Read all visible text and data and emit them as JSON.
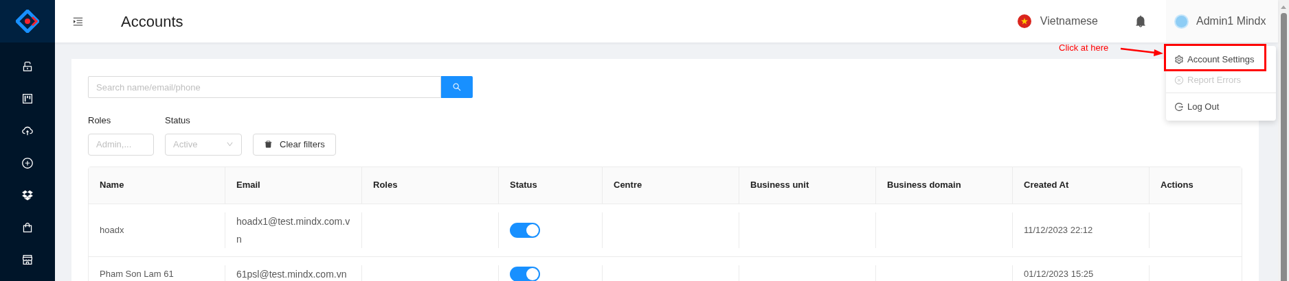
{
  "header": {
    "title": "Accounts",
    "language": "Vietnamese",
    "user": "Admin1 Mindx"
  },
  "user_menu": {
    "items": [
      {
        "kind": "settings",
        "label": "Account Settings",
        "disabled": false
      },
      {
        "kind": "report",
        "label": "Report Errors",
        "disabled": true
      },
      {
        "kind": "logout",
        "label": "Log Out",
        "disabled": false
      }
    ]
  },
  "annotation": {
    "text": "Click at here"
  },
  "search": {
    "placeholder": "Search name/email/phone"
  },
  "filters": {
    "roles": {
      "label": "Roles",
      "placeholder": "Admin,..."
    },
    "status": {
      "label": "Status",
      "placeholder": "Active"
    },
    "clear_button": "Clear filters"
  },
  "table": {
    "columns": [
      "Name",
      "Email",
      "Roles",
      "Status",
      "Centre",
      "Business unit",
      "Business domain",
      "Created At",
      "Actions"
    ],
    "rows": [
      {
        "name": "hoadx",
        "email": "hoadx1@test.mindx.com.vn",
        "status_on": true,
        "created_at": "11/12/2023 22:12"
      },
      {
        "name": "Pham Son Lam 61",
        "email": "61psl@test.mindx.com.vn",
        "status_on": true,
        "created_at": "01/12/2023 15:25"
      }
    ]
  }
}
